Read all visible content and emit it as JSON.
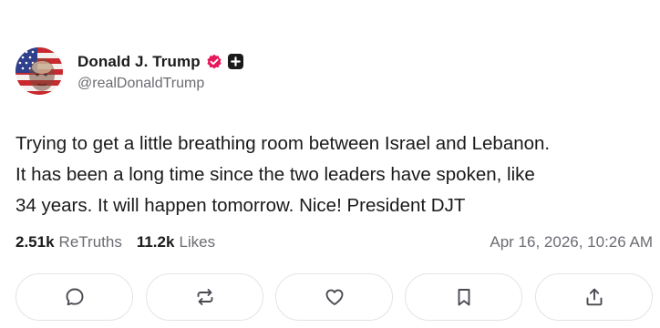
{
  "author": {
    "display_name": "Donald J. Trump",
    "handle": "@realDonaldTrump",
    "avatar_icon": "avatar-flag-portrait",
    "verified_icon": "verified-check-icon",
    "follow_icon": "follow-plus-icon"
  },
  "post": {
    "text": "Trying to get a little breathing room between Israel and Lebanon.\nIt has been a long time since the two leaders have spoken, like\n34 years. It will happen tomorrow. Nice! President DJT"
  },
  "stats": {
    "retruths_count": "2.51k",
    "retruths_label": "ReTruths",
    "likes_count": "11.2k",
    "likes_label": "Likes",
    "timestamp": "Apr 16, 2026, 10:26 AM"
  },
  "actions": [
    {
      "name": "reply",
      "icon": "comment-icon"
    },
    {
      "name": "retruth",
      "icon": "repost-icon"
    },
    {
      "name": "like",
      "icon": "heart-icon"
    },
    {
      "name": "bookmark",
      "icon": "bookmark-icon"
    },
    {
      "name": "share",
      "icon": "share-icon"
    }
  ],
  "colors": {
    "text": "#1a1a1a",
    "muted": "#6b6b73",
    "verified": "#e5195c",
    "border": "#e4e4e8"
  }
}
